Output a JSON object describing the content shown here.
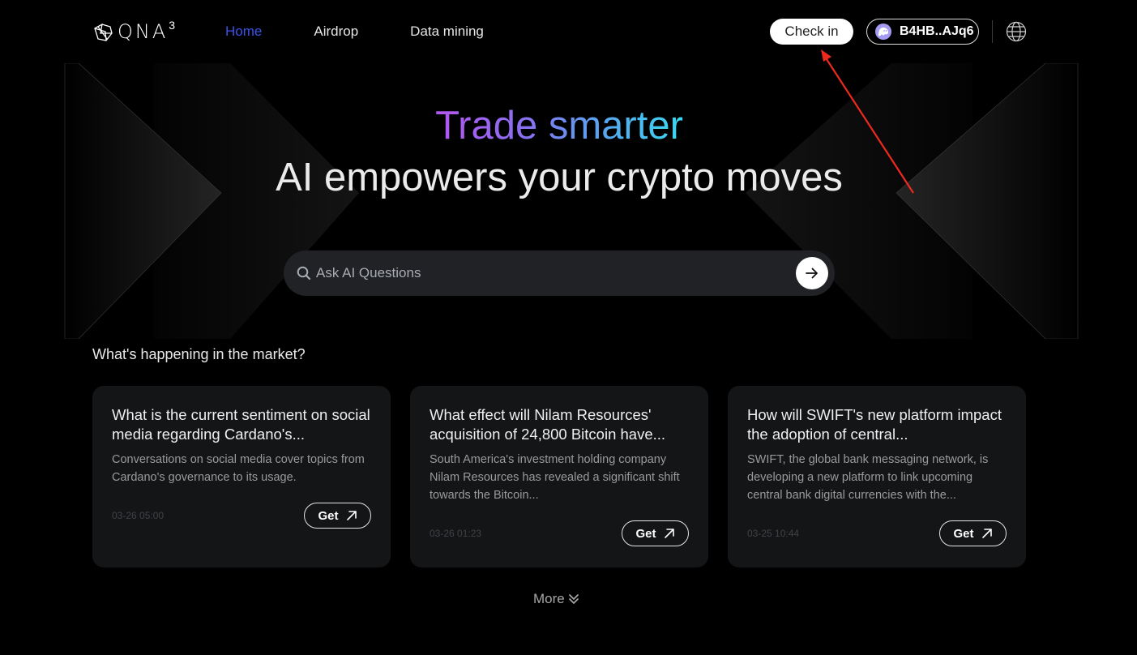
{
  "header": {
    "logo_text": "QNA",
    "logo_sup": "3",
    "nav": [
      {
        "label": "Home",
        "active": true
      },
      {
        "label": "Airdrop",
        "active": false
      },
      {
        "label": "Data mining",
        "active": false
      }
    ],
    "checkin_label": "Check in",
    "wallet_label": "B4HB..AJq6",
    "language_icon": "globe-icon"
  },
  "hero": {
    "title_gradient": "Trade smarter",
    "title_main": "AI empowers your crypto moves",
    "search_placeholder": "Ask AI Questions",
    "search_value": ""
  },
  "market": {
    "title": "What's happening in the market?",
    "cards": [
      {
        "title": "What is the current sentiment on social media regarding Cardano's...",
        "desc": "Conversations on social media cover topics from Cardano's governance to its usage.",
        "time": "03-26 05:00",
        "button": "Get"
      },
      {
        "title": "What effect will Nilam Resources' acquisition of 24,800 Bitcoin have...",
        "desc": "South America's investment holding company Nilam Resources has revealed a significant shift towards the Bitcoin...",
        "time": "03-26 01:23",
        "button": "Get"
      },
      {
        "title": "How will SWIFT's new platform impact the adoption of central...",
        "desc": "SWIFT, the global bank messaging network, is developing a new platform to link upcoming central bank digital currencies with the...",
        "time": "03-25 10:44",
        "button": "Get"
      }
    ],
    "more_label": "More"
  },
  "colors": {
    "nav_active": "#3b54e8",
    "annotation_arrow": "#ee2a1e",
    "wallet_avatar": "#a59cf2"
  }
}
